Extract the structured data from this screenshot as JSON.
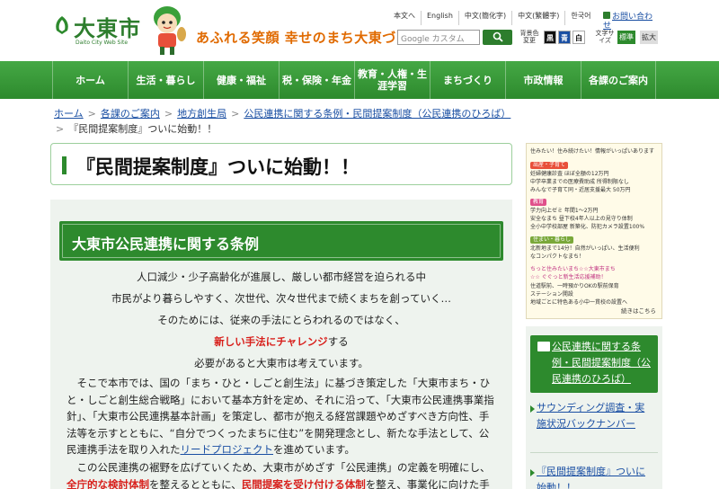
{
  "header": {
    "logo_text": "大東市",
    "logo_sub": "Daito City Web Site",
    "tagline": "あふれる笑顔 幸せのまち大東づくり",
    "languages": [
      "本文へ",
      "English",
      "中文(簡化字)",
      "中文(繁體字)",
      "한국어"
    ],
    "contact_label": "お問い合わせ",
    "search_placeholder": "Google カスタム",
    "bg_color_label": "背景色変更",
    "bg_options": [
      "黒",
      "青",
      "白"
    ],
    "font_size_label": "文字サイズ",
    "font_size_options": [
      "標準",
      "拡大"
    ],
    "colors": {
      "brand_green": "#2d8a2d",
      "accent_orange": "#e06a00"
    }
  },
  "nav": {
    "items": [
      "ホーム",
      "生活・暮らし",
      "健康・福祉",
      "税・保険・年金",
      "教育・人権・生涯学習",
      "まちづくり",
      "市政情報",
      "各課のご案内"
    ]
  },
  "breadcrumb": {
    "items": [
      "ホーム",
      "各課のご案内",
      "地方創生局",
      "公民連携に関する条例・民間提案制度（公民連携のひろば）"
    ],
    "current": "『民間提案制度』ついに始動！！"
  },
  "page": {
    "title": "『民間提案制度』ついに始動！！",
    "section_title": "大東市公民連携に関する条例",
    "lines": [
      "人口減少・少子高齢化が進展し、厳しい都市経営を迫られる中",
      "市民がより暮らしやすく、次世代、次々世代まで続くまちを創っていく…",
      "そのためには、従来の手法にとらわれるのではなく、"
    ],
    "red_phrase": "新しい手法にチャレンジ",
    "red_suffix": "する",
    "line5": "必要があると大東市は考えています。",
    "para1": "そこで本市では、国の「まち・ひと・しごと創生法」に基づき策定した「大東市まち・ひと・しごと創生総合戦略」において基本方針を定め、それに沿って、「大東市公民連携事業指針」、「大東市公民連携基本計画」を策定し、都市が抱える経営課題やめざすべき方向性、手法等を示すとともに、“自分でつくったまちに住む”を開発理念とし、新たな手法として、公民連携手法を取り入れた",
    "para1_link": "リードプロジェクト",
    "para1_end": "を進めています。",
    "para2_a": "この公民連携の裾野を広げていくため、大東市がめざす「公民連携」の定義を明確にし、",
    "para2_red1": "全庁的な検討体制",
    "para2_b": "を整えるとともに、",
    "para2_red2": "民間提案を受け付ける体制",
    "para2_c": "を整え、事業化に向けた手続を"
  },
  "banner": {
    "headline": "住みたい！住み続けたい！情報がいっぱいあります",
    "tag1": "出産・子育て",
    "lines1": [
      "妊婦健康診査 ほぼ全額の12万円",
      "中学卒業までの医療費助成 所得制限なし",
      "みんなで子育て同・近居支援最大 50万円"
    ],
    "tag2": "教育",
    "lines2": [
      "学力向上ゼミ 年間1～2万円",
      "安全なまち 昼下校4年人以上の見守り体制",
      "全小中学校部屋 新築化、防犯カメラ設置100%"
    ],
    "tag3": "住まい・暮らし",
    "lines3": [
      "北新地まで14分！自然がいっぱい、生活便利",
      "なコンパクトなまち！"
    ],
    "lines4": [
      "ちっと住みたいまち☆☆大東市まち",
      "☆☆ ぐぐっと新生活応援補助！",
      "住道駅前、一時預かりOKの駅前保育",
      "ステーション開設",
      "地域ごとに特色ある小中一貫校の設置へ"
    ],
    "more": "続きはこちら"
  },
  "sidebar": {
    "head": "公民連携に関する条例・民間提案制度（公民連携のひろば）",
    "links": [
      "サウンディング調査・実施状況バックナンバー",
      "『民間提案制度』ついに始動！！"
    ]
  }
}
